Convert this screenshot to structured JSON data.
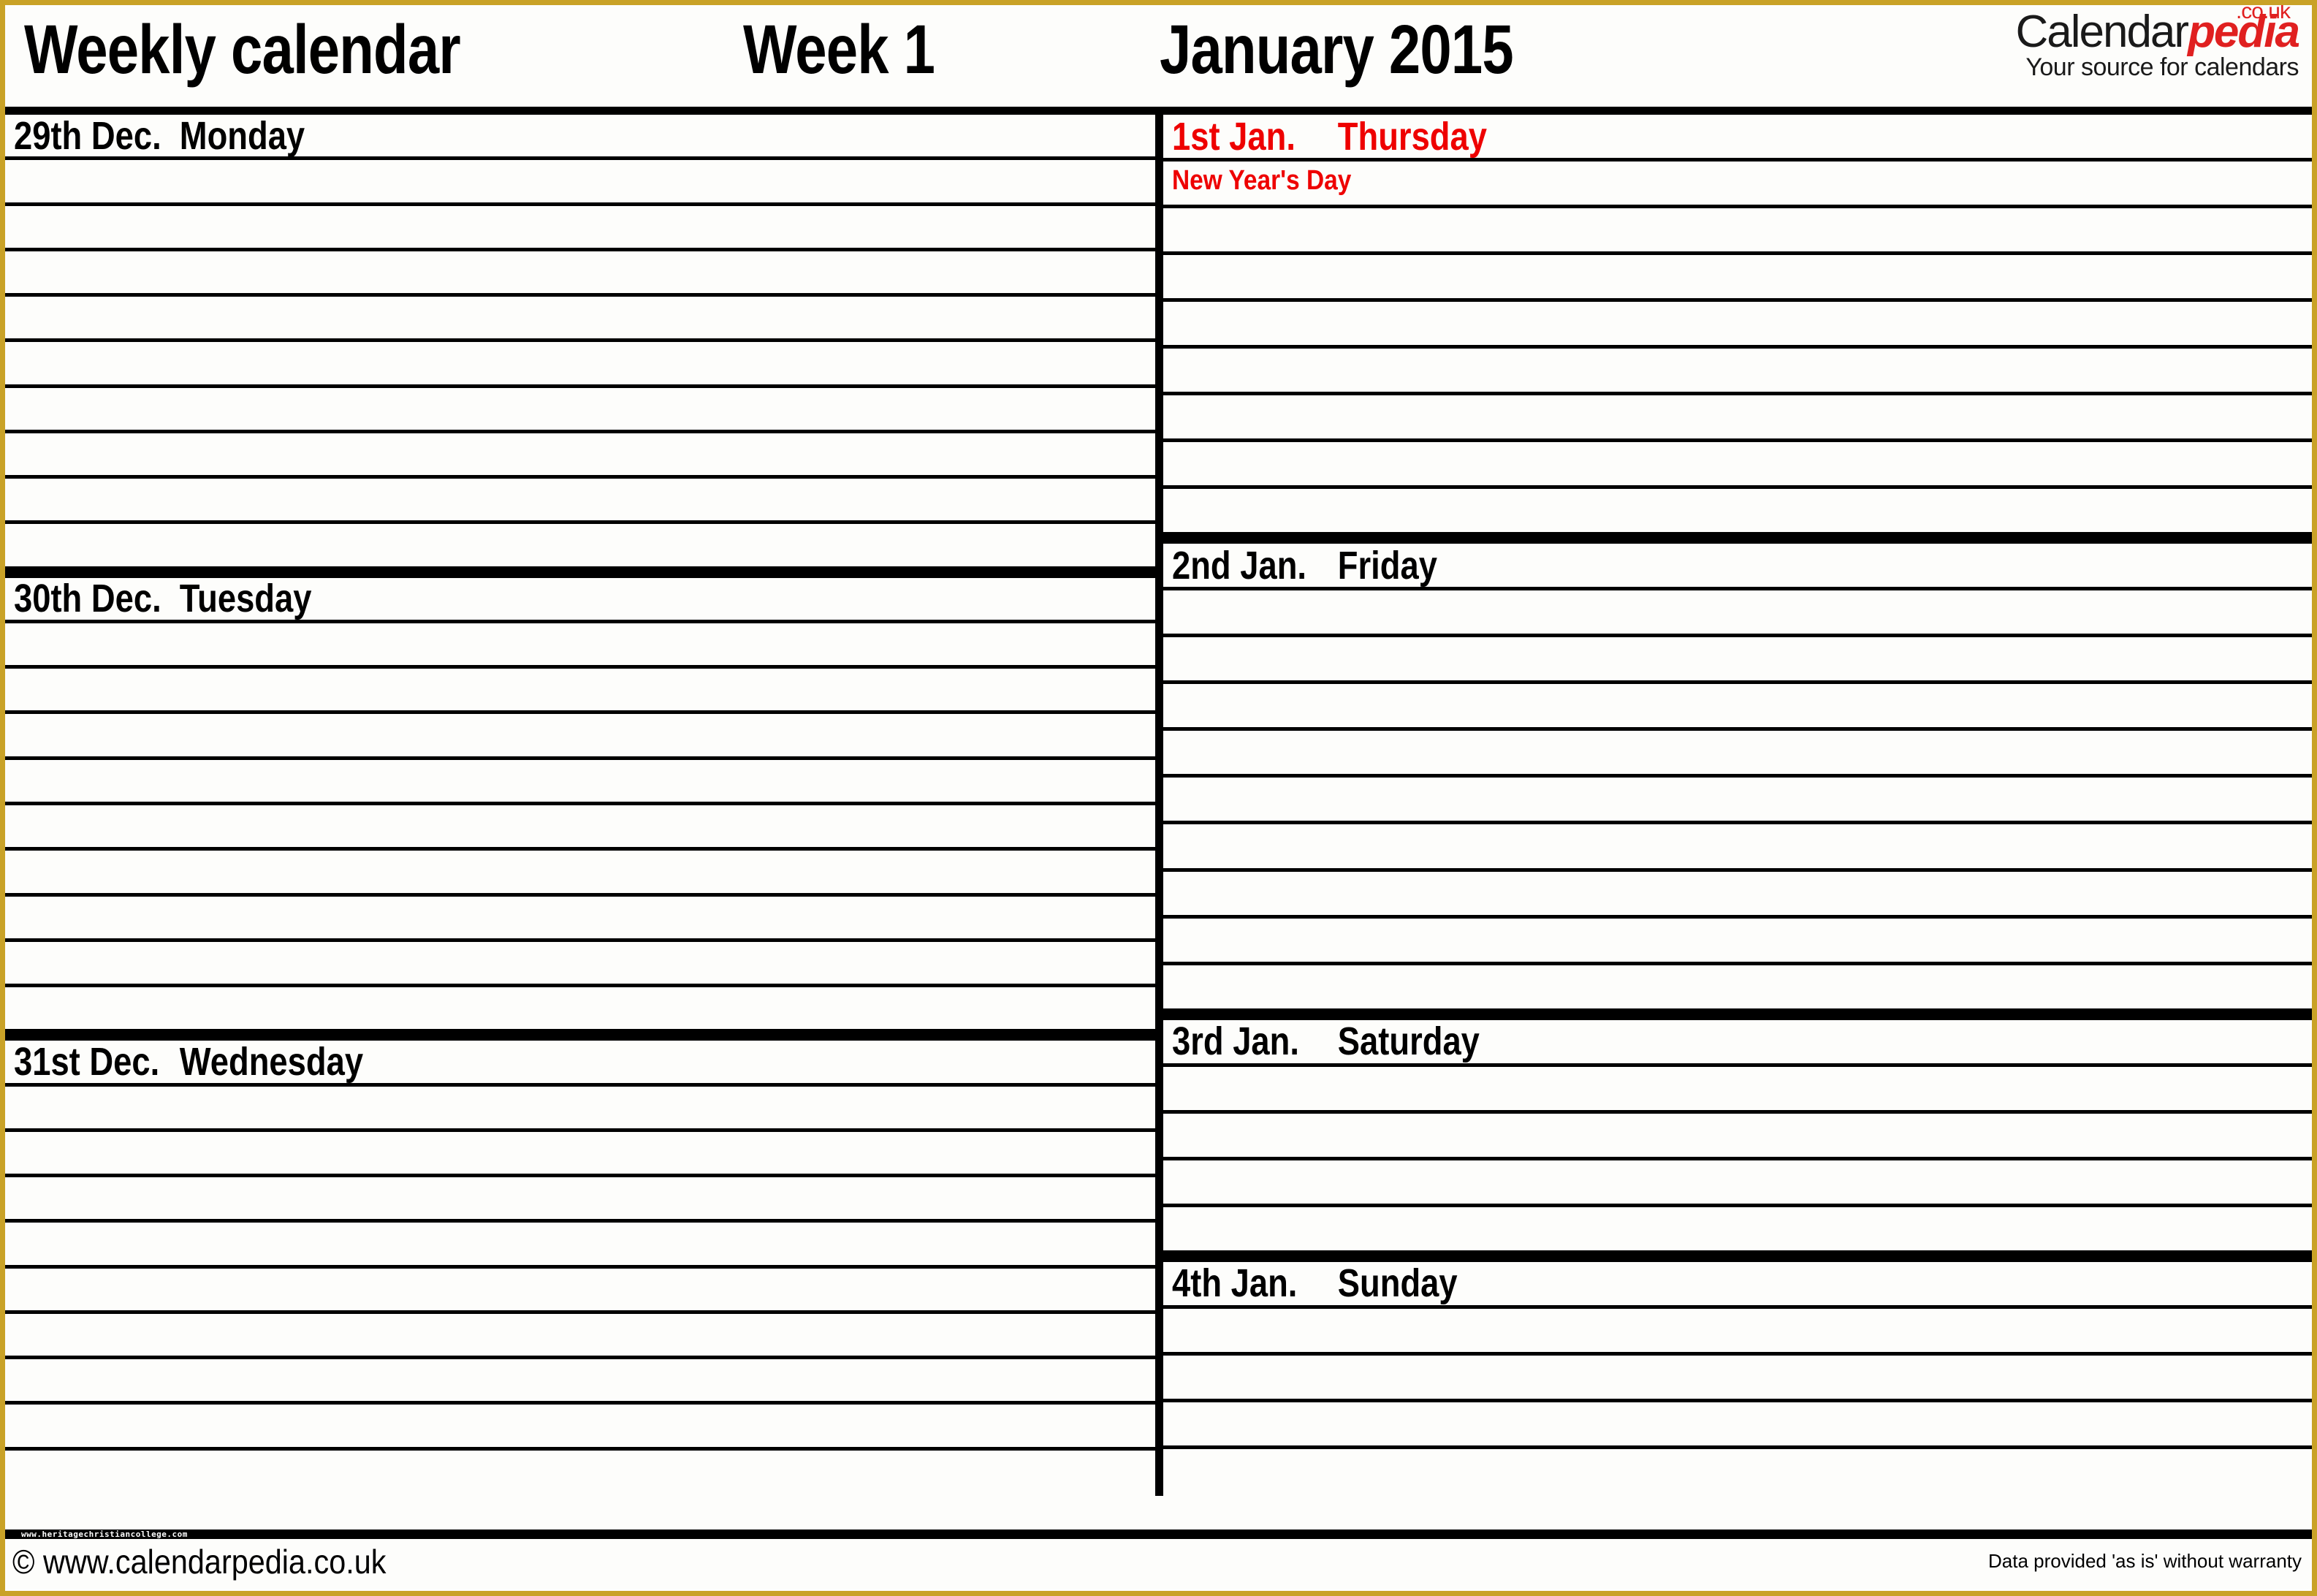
{
  "header": {
    "title": "Weekly calendar",
    "week_label": "Week 1",
    "month_year": "January 2015",
    "logo": {
      "brand_main": "Calendar",
      "brand_accent": "pedia",
      "tld": ".co.uk",
      "tagline": "Your source for calendars",
      "accent_color": "#e02020"
    }
  },
  "colors": {
    "border_outer": "#c9a227",
    "rule": "#000000",
    "holiday": "#ee0000",
    "page_background": "#fdfdfb"
  },
  "left_column": [
    {
      "date": "29th Dec.",
      "weekday": "Monday",
      "holiday": "",
      "is_holiday": false,
      "blank_rows": 9
    },
    {
      "date": "30th Dec.",
      "weekday": "Tuesday",
      "holiday": "",
      "is_holiday": false,
      "blank_rows": 9
    },
    {
      "date": "31st Dec.",
      "weekday": "Wednesday",
      "holiday": "",
      "is_holiday": false,
      "blank_rows": 9
    }
  ],
  "right_column": [
    {
      "date": "1st Jan.",
      "weekday": "Thursday",
      "holiday": "New Year's Day",
      "is_holiday": true,
      "blank_rows": 8
    },
    {
      "date": "2nd Jan.",
      "weekday": "Friday",
      "holiday": "",
      "is_holiday": false,
      "blank_rows": 9
    },
    {
      "date": "3rd Jan.",
      "weekday": "Saturday",
      "holiday": "",
      "is_holiday": false,
      "blank_rows": 4
    },
    {
      "date": "4th Jan.",
      "weekday": "Sunday",
      "holiday": "",
      "is_holiday": false,
      "blank_rows": 4
    }
  ],
  "footer": {
    "copyright": "© www.calendarpedia.co.uk",
    "warranty": "Data provided 'as is' without warranty",
    "watermark": "www.heritagechristiancollege.com"
  }
}
